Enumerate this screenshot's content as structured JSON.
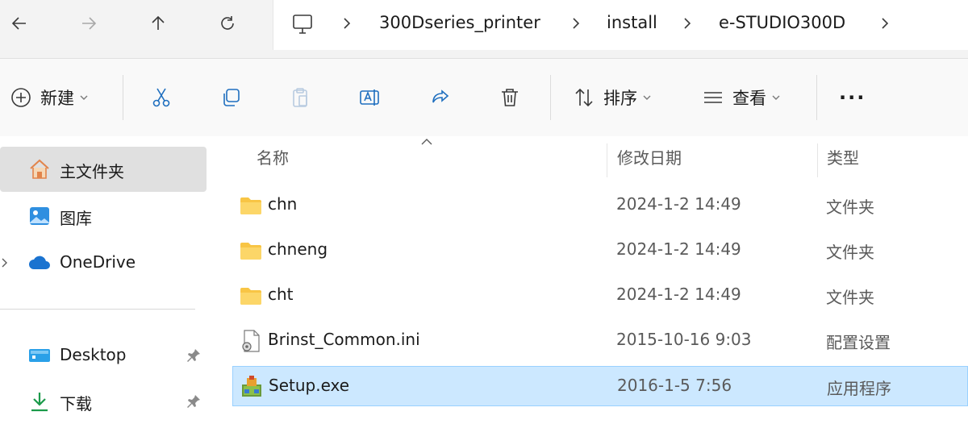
{
  "nav": {
    "back": "back-arrow-icon",
    "forward": "forward-arrow-icon",
    "up": "up-arrow-icon",
    "refresh": "refresh-icon"
  },
  "breadcrumb": {
    "root_icon": "this-pc-icon",
    "items": [
      "300Dseries_printer",
      "install",
      "e-STUDIO300D"
    ]
  },
  "toolbar": {
    "new_label": "新建",
    "sort_label": "排序",
    "view_label": "查看",
    "more_label": "···"
  },
  "sidebar": {
    "items": [
      {
        "label": "主文件夹",
        "icon": "home-icon"
      },
      {
        "label": "图库",
        "icon": "gallery-icon"
      },
      {
        "label": "OneDrive",
        "icon": "onedrive-cloud-icon"
      },
      {
        "label": "Desktop",
        "icon": "desktop-icon"
      },
      {
        "label": "下载",
        "icon": "download-icon"
      }
    ]
  },
  "columns": {
    "name": "名称",
    "modified": "修改日期",
    "type": "类型"
  },
  "files": [
    {
      "name": "chn",
      "date": "2024-1-2 14:49",
      "type": "文件夹",
      "icon": "folder-icon"
    },
    {
      "name": "chneng",
      "date": "2024-1-2 14:49",
      "type": "文件夹",
      "icon": "folder-icon"
    },
    {
      "name": "cht",
      "date": "2024-1-2 14:49",
      "type": "文件夹",
      "icon": "folder-icon"
    },
    {
      "name": "Brinst_Common.ini",
      "date": "2015-10-16 9:03",
      "type": "配置设置",
      "icon": "ini-settings-file-icon"
    },
    {
      "name": "Setup.exe",
      "date": "2016-1-5 7:56",
      "type": "应用程序",
      "icon": "setup-exe-icon"
    }
  ],
  "colors": {
    "selected_row": "#cce8ff",
    "folder": "#f8c545",
    "accent": "#0067c0"
  }
}
